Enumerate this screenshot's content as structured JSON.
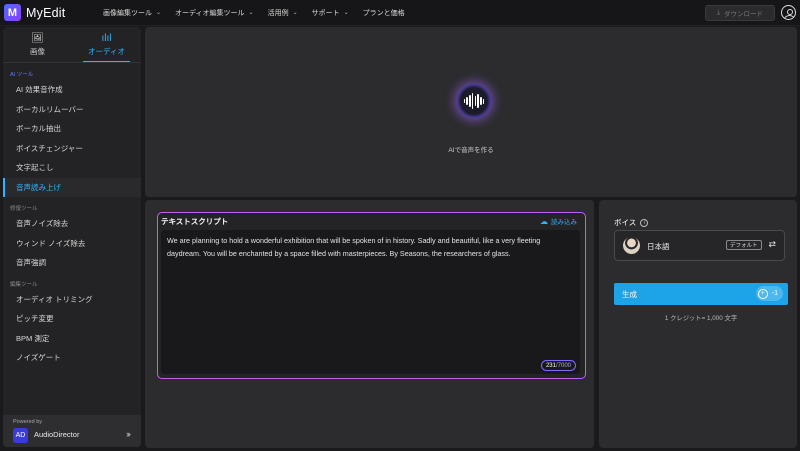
{
  "app": {
    "logo_letter": "M",
    "name": "MyEdit"
  },
  "nav": {
    "items": [
      {
        "label": "画像編集ツール",
        "dropdown": true
      },
      {
        "label": "オーディオ編集ツール",
        "dropdown": true
      },
      {
        "label": "活用例",
        "dropdown": true
      },
      {
        "label": "サポート",
        "dropdown": true
      },
      {
        "label": "プランと価格",
        "dropdown": false
      }
    ],
    "download_label": "ダウンロード"
  },
  "sidebar": {
    "tabs": [
      {
        "label": "画像",
        "icon": "image-icon",
        "active": false
      },
      {
        "label": "オーディオ",
        "icon": "audio-wave-icon",
        "active": true
      }
    ],
    "sections": [
      {
        "title": "AI ツール",
        "items": [
          "AI 効果音作成",
          "ボーカルリムーバー",
          "ボーカル抽出",
          "ボイスチェンジャー",
          "文字起こし",
          "音声読み上げ"
        ]
      },
      {
        "title": "修復ツール",
        "items": [
          "音声ノイズ除去",
          "ウィンド ノイズ除去",
          "音声強調"
        ]
      },
      {
        "title": "編集ツール",
        "items": [
          "オーディオ トリミング",
          "ピッチ変更",
          "BPM 測定",
          "ノイズゲート"
        ]
      }
    ],
    "active_item": "音声読み上げ",
    "powered_by": "Powered by",
    "partner_name": "AudioDirector",
    "partner_logo": "AD"
  },
  "preview": {
    "caption": "AIで音声を作る"
  },
  "script": {
    "title": "テキストスクリプト",
    "upload_label": "読み込み",
    "text": "We are planning to hold a wonderful exhibition that will be spoken of in history.  Sadly and beautiful, like a very fleeting daydream. You will be enchanted by a space filled with masterpieces. By Seasons, the researchers of glass.",
    "count": "231",
    "max": "/7000"
  },
  "voice": {
    "title": "ボイス",
    "language": "日本語",
    "badge": "デフォルト",
    "generate_label": "生成",
    "cost": "-1",
    "credit_note": "1 クレジット= 1,000 文字"
  },
  "colors": {
    "accent": "#2fb4ff",
    "generate": "#1da3e8",
    "script_border": "#c05ff0",
    "section": "#6b7cff"
  }
}
